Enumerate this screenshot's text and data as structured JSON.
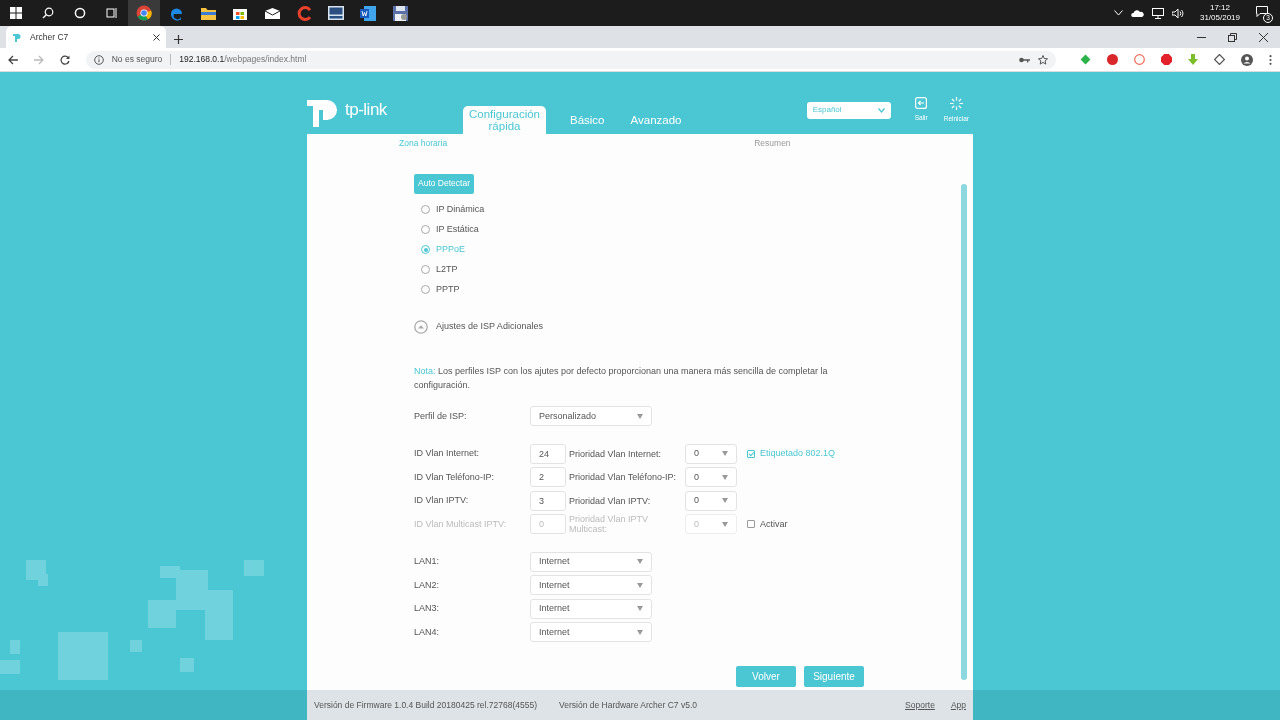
{
  "taskbar": {
    "time": "17:12",
    "date": "31/05/2019",
    "notifications": "3"
  },
  "browser": {
    "tab_title": "Archer C7",
    "security": "No es seguro",
    "url_host": "192.168.0.1",
    "url_path": "/webpages/index.html"
  },
  "header": {
    "logo": "tp-link",
    "language": "Español",
    "actions": [
      "Salir",
      "Reiniciar"
    ],
    "nav": [
      {
        "label": "Configuración rápida",
        "selected": true
      },
      {
        "label": "Básico",
        "selected": false
      },
      {
        "label": "Avanzado",
        "selected": false
      }
    ]
  },
  "steps": [
    "Zona horaria",
    "Resumen"
  ],
  "auto_detect": "Auto Detectar",
  "connection_types": [
    {
      "label": "IP Dinámica",
      "selected": false
    },
    {
      "label": "IP Estática",
      "selected": false
    },
    {
      "label": "PPPoE",
      "selected": true
    },
    {
      "label": "L2TP",
      "selected": false
    },
    {
      "label": "PPTP",
      "selected": false
    }
  ],
  "isp_toggle": {
    "label": "Ajustes de ISP Adicionales",
    "expanded": true
  },
  "note": {
    "label": "Nota:",
    "text": "Los perfiles ISP con los ajutes por defecto proporcionan una manera más sencilla de completar la configuración."
  },
  "isp_profile": {
    "label": "Perfil de ISP:",
    "value": "Personalizado"
  },
  "vlans": [
    {
      "id_label": "ID Vlan Internet:",
      "id_value": "24",
      "priority_label": "Prioridad Vlan Internet:",
      "priority_value": "0",
      "disabled": false,
      "check": {
        "label": "Etiquetado 802.1Q",
        "checked": true
      }
    },
    {
      "id_label": "ID Vlan Teléfono-IP:",
      "id_value": "2",
      "priority_label": "Prioridad Vlan Teléfono-IP:",
      "priority_value": "0",
      "disabled": false
    },
    {
      "id_label": "ID Vlan IPTV:",
      "id_value": "3",
      "priority_label": "Prioridad Vlan IPTV:",
      "priority_value": "0",
      "disabled": false
    },
    {
      "id_label": "ID Vlan Multicast IPTV:",
      "id_value": "0",
      "priority_label": "Prioridad Vlan IPTV Multicast:",
      "priority_value": "0",
      "disabled": true,
      "check": {
        "label": "Activar",
        "checked": false
      }
    }
  ],
  "lan_ports": [
    {
      "label": "LAN1:",
      "value": "Internet"
    },
    {
      "label": "LAN2:",
      "value": "Internet"
    },
    {
      "label": "LAN3:",
      "value": "Internet"
    },
    {
      "label": "LAN4:",
      "value": "Internet"
    }
  ],
  "buttons": [
    "Volver",
    "Siguiente"
  ],
  "footer": {
    "firmware": "Versión de Firmware 1.0.4 Build 20180425 rel.72768(4555)",
    "hardware": "Versión de Hardware Archer C7 v5.0",
    "links": [
      "Soporte",
      "App"
    ]
  }
}
